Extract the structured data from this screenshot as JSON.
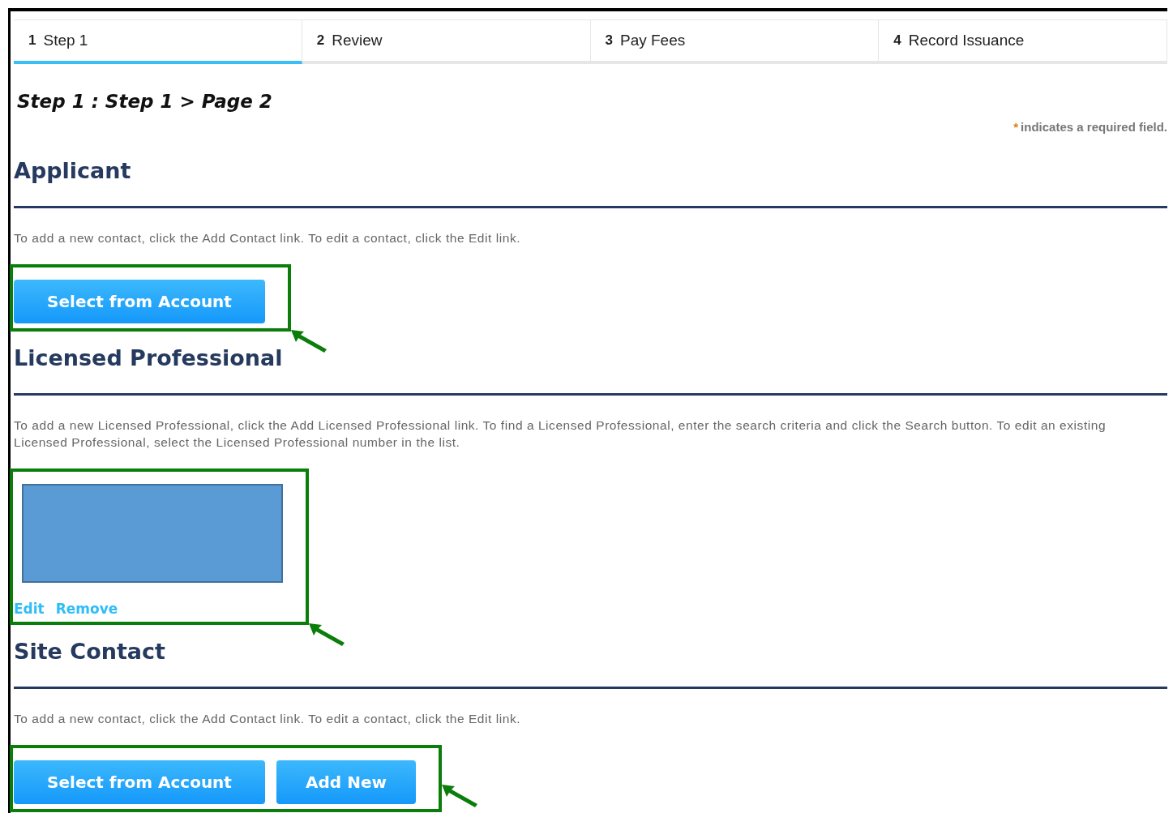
{
  "tabs": [
    {
      "number": "1",
      "label": "Step 1",
      "selected": true
    },
    {
      "number": "2",
      "label": "Review",
      "selected": false
    },
    {
      "number": "3",
      "label": "Pay Fees",
      "selected": false
    },
    {
      "number": "4",
      "label": "Record Issuance",
      "selected": false
    }
  ],
  "page_title": "Step 1 : Step 1 > Page 2",
  "required_note": {
    "mark": "*",
    "text": "indicates a required field."
  },
  "sections": [
    {
      "heading": "Applicant",
      "instructions": "To add a new contact, click the Add Contact link. To edit a contact, click the Edit link.",
      "highlighted": true,
      "items": [
        {
          "kind": "button",
          "label": "Select from Account"
        }
      ]
    },
    {
      "heading": "Licensed Professional",
      "instructions": "To add a new Licensed Professional, click the Add Licensed Professional link. To find a Licensed Professional, enter the search criteria and click the Search button. To edit an existing Licensed Professional, select the Licensed Professional number in the list.",
      "highlighted": true,
      "items": [
        {
          "kind": "redacted"
        },
        {
          "kind": "links",
          "links": [
            "Edit",
            "Remove"
          ]
        }
      ]
    },
    {
      "heading": "Site Contact",
      "instructions": "To add a new contact, click the Add Contact link. To edit a contact, click the Edit link.",
      "highlighted": true,
      "items": [
        {
          "kind": "button",
          "label": "Select from Account"
        },
        {
          "kind": "button",
          "label": "Add New"
        }
      ]
    }
  ]
}
